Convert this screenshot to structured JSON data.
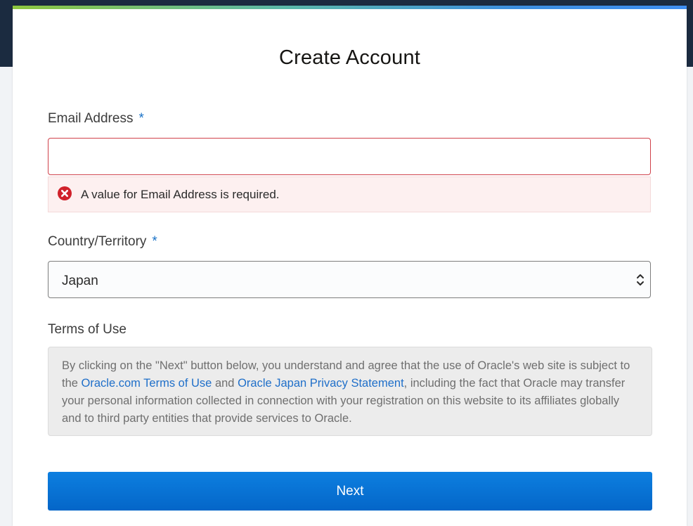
{
  "page": {
    "title": "Create Account",
    "accent_colors": [
      "#8dc63f",
      "#3f8ef0"
    ]
  },
  "form": {
    "email": {
      "label": "Email Address",
      "required_mark": "*",
      "value": "",
      "placeholder": "",
      "error": "A value for Email Address is required.",
      "error_icon": "error-circle-x-icon",
      "error_color": "#d0414a"
    },
    "country": {
      "label": "Country/Territory",
      "required_mark": "*",
      "selected": "Japan",
      "icon": "select-chevrons-icon"
    },
    "terms": {
      "heading": "Terms of Use",
      "text_before": "By clicking on the \"Next\" button below, you understand and agree that the use of Oracle's web site is subject to the ",
      "link1": "Oracle.com Terms of Use",
      "text_middle": " and ",
      "link2": "Oracle Japan Privacy Statement",
      "text_after": ", including the fact that Oracle may transfer your personal information collected in connection with your registration on this website to its affiliates globally and to third party entities that provide services to Oracle."
    },
    "next_label": "Next",
    "button_color": "#0672d4"
  }
}
